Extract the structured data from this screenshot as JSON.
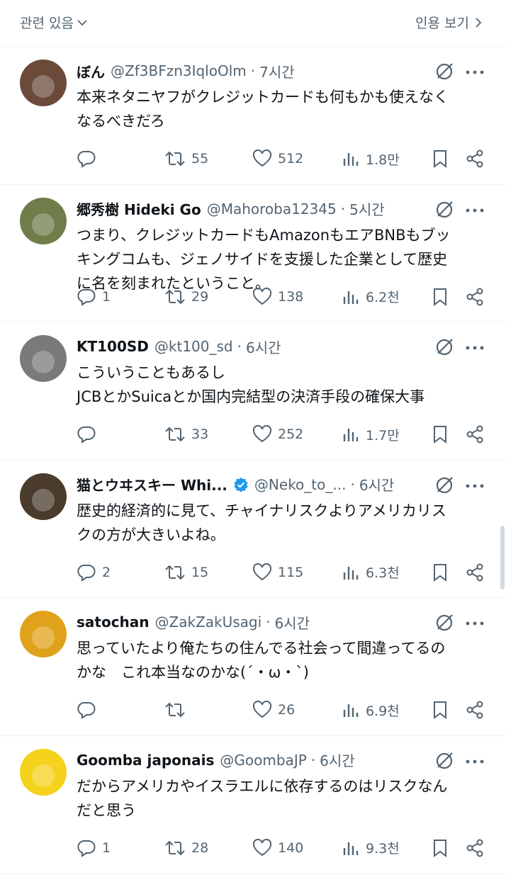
{
  "header": {
    "left_label": "관련 있음",
    "right_label": "인용 보기"
  },
  "tweets": [
    {
      "name": "ぼん",
      "handle": "@Zf3BFzn3IqloOlm",
      "time": "7시간",
      "text": "本来ネタニヤフがクレジットカードも何もかも使えなく\nなるべきだろ",
      "replies": "",
      "retweets": "55",
      "likes": "512",
      "views": "1.8만",
      "verified": false,
      "avatar_color": "#6b4a3a"
    },
    {
      "name": "郷秀樹 Hideki Go",
      "handle": "@Mahoroba12345",
      "time": "5시간",
      "text": "つまり、クレジットカードもAmazonもエアBNBもブッ\nキングコムも、ジェノサイドを支援した企業として歴史\nに名を刻まれたということ。",
      "replies": "1",
      "retweets": "29",
      "likes": "138",
      "views": "6.2천",
      "verified": false,
      "avatar_color": "#6f7d4a"
    },
    {
      "name": "KT100SD",
      "handle": "@kt100_sd",
      "time": "6시간",
      "text": "こういうこともあるし\nJCBとかSuicaとか国内完結型の決済手段の確保大事",
      "replies": "",
      "retweets": "33",
      "likes": "252",
      "views": "1.7만",
      "verified": false,
      "avatar_color": "#7a7a7a"
    },
    {
      "name": "猫とウヰスキー Whi...",
      "handle": "@Neko_to_...",
      "time": "6시간",
      "text": "歴史的経済的に見て、チャイナリスクよりアメリカリス\nクの方が大きいよね。",
      "replies": "2",
      "retweets": "15",
      "likes": "115",
      "views": "6.3천",
      "verified": true,
      "avatar_color": "#4a3b2c"
    },
    {
      "name": "satochan",
      "handle": "@ZakZakUsagi",
      "time": "6시간",
      "text": "思っていたより俺たちの住んでる社会って間違ってるの\nかな　これ本当なのかな(´・ω・`)",
      "replies": "",
      "retweets": "",
      "likes": "26",
      "views": "6.9천",
      "verified": false,
      "avatar_color": "#e0a21a"
    },
    {
      "name": "Goomba japonais",
      "handle": "@GoombaJP",
      "time": "6시간",
      "text": "だからアメリカやイスラエルに依存するのはリスクなん\nだと思う",
      "replies": "1",
      "retweets": "28",
      "likes": "140",
      "views": "9.3천",
      "verified": false,
      "avatar_color": "#f5d21c"
    }
  ],
  "colors": {
    "text": "#0f1419",
    "secondary": "#536471",
    "verified_badge": "#1d9bf0",
    "divider": "#eff3f4"
  }
}
